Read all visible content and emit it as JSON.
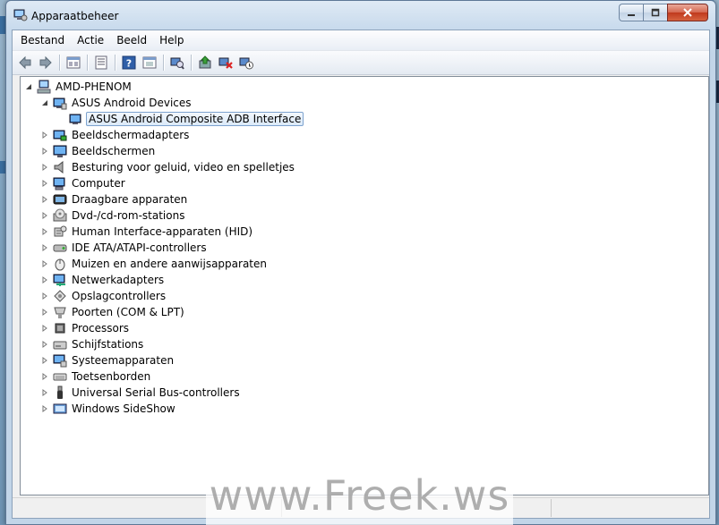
{
  "window": {
    "title": "Apparaatbeheer",
    "title_icon": "device-manager-icon",
    "buttons": {
      "minimize": "minimize-icon",
      "maximize": "maximize-icon",
      "close": "close-icon"
    }
  },
  "menubar": [
    {
      "label": "Bestand"
    },
    {
      "label": "Actie"
    },
    {
      "label": "Beeld"
    },
    {
      "label": "Help"
    }
  ],
  "toolbar": [
    "back-arrow-icon",
    "forward-arrow-icon",
    "properties-view-icon",
    "list-view-icon",
    "help-icon",
    "show-hidden-icon",
    "scan-hardware-icon",
    "update-driver-icon",
    "uninstall-icon",
    "disable-icon"
  ],
  "tree": {
    "root": {
      "label": "AMD-PHENOM",
      "icon": "computer-network-icon"
    },
    "expanded_category": {
      "label": "ASUS Android Devices",
      "icon": "android-device-icon"
    },
    "selected_device": {
      "label": "ASUS Android Composite ADB Interface",
      "icon": "adb-interface-icon"
    },
    "categories": [
      {
        "label": "Beeldschermadapters",
        "icon": "display-adapter-icon"
      },
      {
        "label": "Beeldschermen",
        "icon": "monitor-icon"
      },
      {
        "label": "Besturing voor geluid, video en spelletjes",
        "icon": "speaker-icon"
      },
      {
        "label": "Computer",
        "icon": "computer-icon"
      },
      {
        "label": "Draagbare apparaten",
        "icon": "portable-device-icon"
      },
      {
        "label": "Dvd-/cd-rom-stations",
        "icon": "dvd-drive-icon"
      },
      {
        "label": "Human Interface-apparaten (HID)",
        "icon": "hid-icon"
      },
      {
        "label": "IDE ATA/ATAPI-controllers",
        "icon": "ide-controller-icon"
      },
      {
        "label": "Muizen en andere aanwijsapparaten",
        "icon": "mouse-icon"
      },
      {
        "label": "Netwerkadapters",
        "icon": "network-adapter-icon"
      },
      {
        "label": "Opslagcontrollers",
        "icon": "storage-controller-icon"
      },
      {
        "label": "Poorten (COM & LPT)",
        "icon": "port-icon"
      },
      {
        "label": "Processors",
        "icon": "processor-icon"
      },
      {
        "label": "Schijfstations",
        "icon": "disk-drive-icon"
      },
      {
        "label": "Systeemapparaten",
        "icon": "system-device-icon"
      },
      {
        "label": "Toetsenborden",
        "icon": "keyboard-icon"
      },
      {
        "label": "Universal Serial Bus-controllers",
        "icon": "usb-icon"
      },
      {
        "label": "Windows SideShow",
        "icon": "sideshow-icon"
      }
    ]
  },
  "watermark": "www.Freek.ws",
  "colors": {
    "selection_border": "#7da2ce",
    "selection_fill": "#dbeaf9",
    "close_button": "#c0391d"
  }
}
